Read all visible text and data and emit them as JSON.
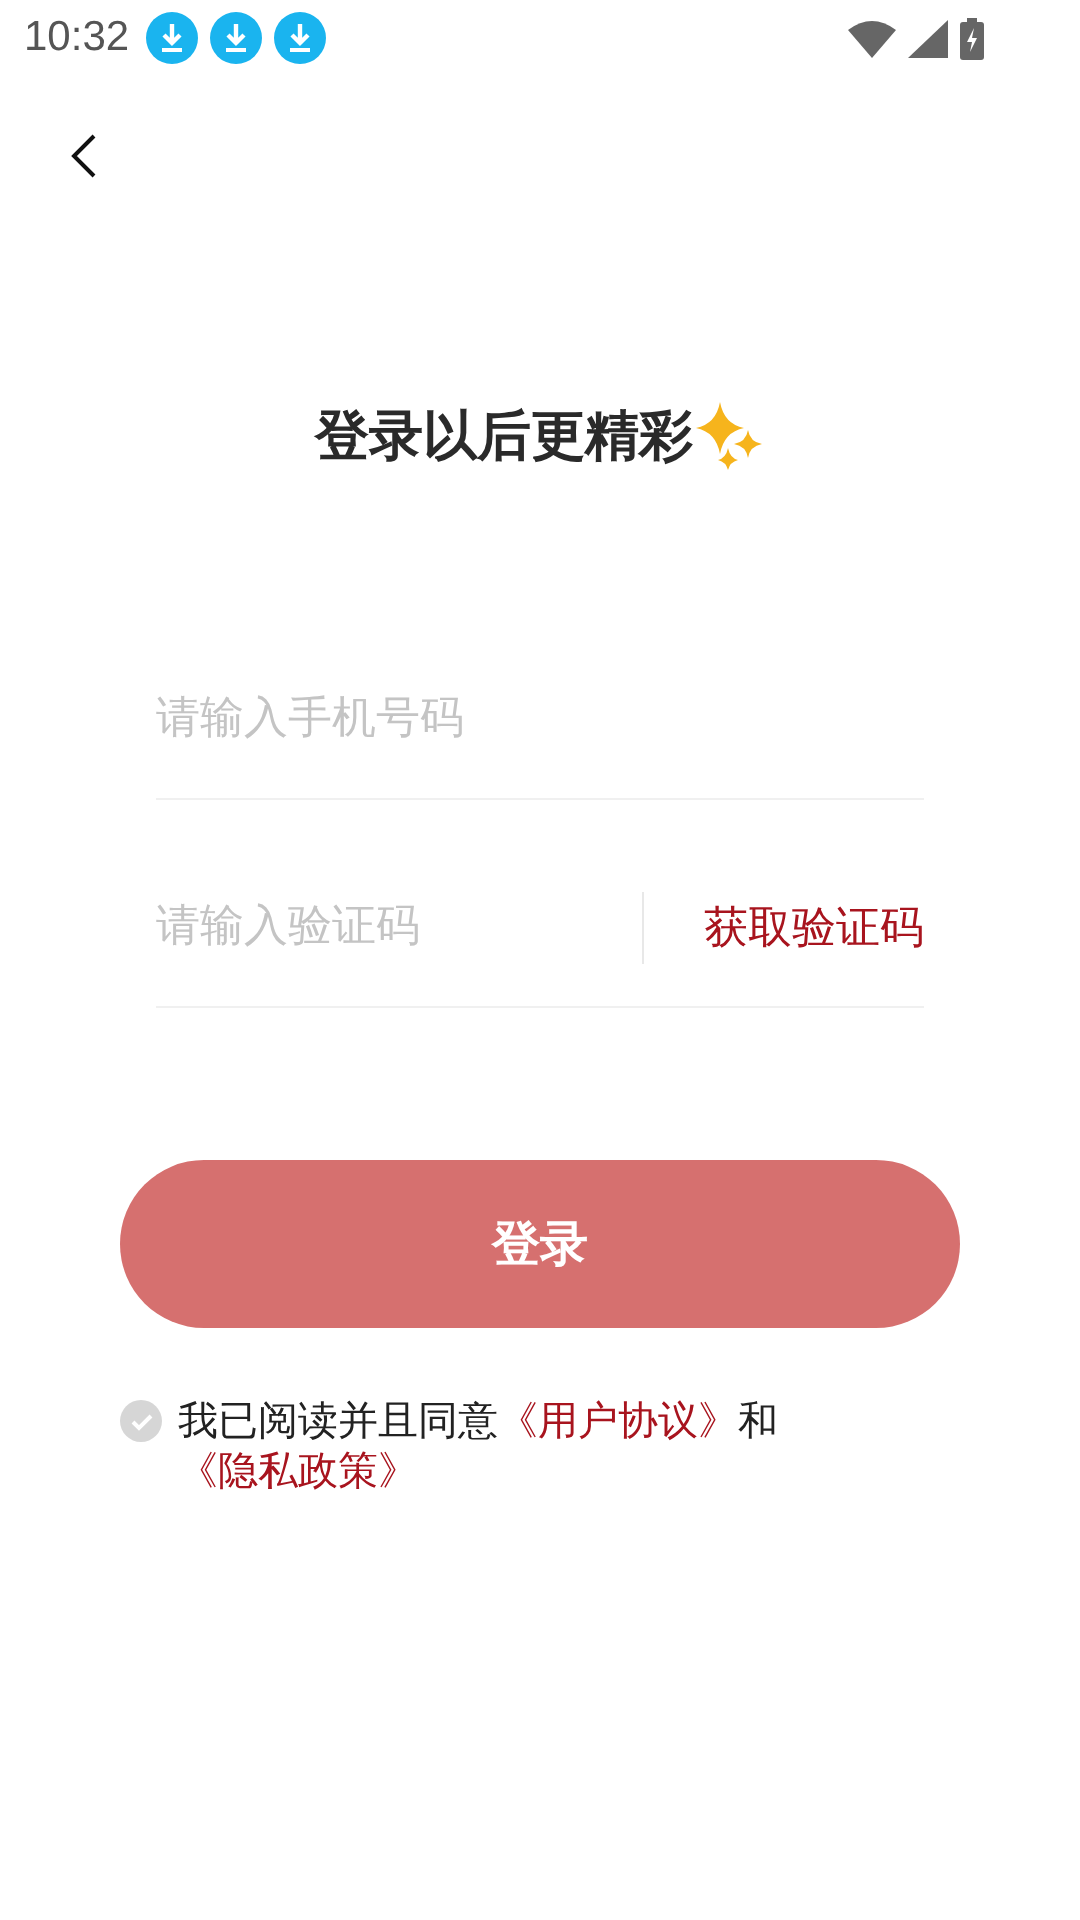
{
  "status_bar": {
    "time": "10:32"
  },
  "title": "登录以后更精彩",
  "phone_field": {
    "placeholder": "请输入手机号码"
  },
  "code_field": {
    "placeholder": "请输入验证码"
  },
  "get_code_button": "获取验证码",
  "login_button": {
    "label": "登录",
    "disabled": true
  },
  "agreement": {
    "checked": false,
    "parts": [
      {
        "kind": "text",
        "text": "我已阅读并且同意"
      },
      {
        "kind": "link",
        "text": "《用户协议》"
      },
      {
        "kind": "text",
        "text": "和"
      },
      {
        "kind": "link",
        "text": "《隐私政策》"
      }
    ]
  }
}
